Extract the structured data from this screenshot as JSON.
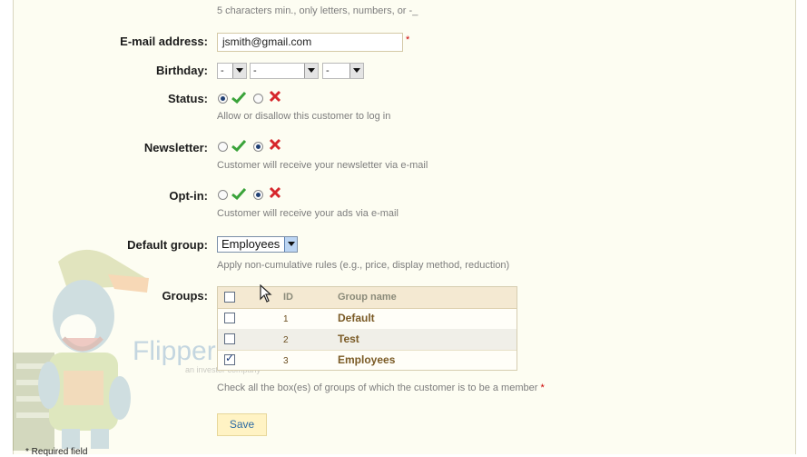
{
  "username_hint": "5 characters min., only letters, numbers, or -_",
  "email": {
    "label": "E-mail address:",
    "value": "jsmith@gmail.com",
    "required_mark": "*"
  },
  "birthday": {
    "label": "Birthday:",
    "day": "-",
    "month": "-",
    "year": "-"
  },
  "status": {
    "label": "Status:",
    "hint": "Allow or disallow this customer to log in",
    "selected": "enabled"
  },
  "newsletter": {
    "label": "Newsletter:",
    "hint": "Customer will receive your newsletter via e-mail",
    "selected": "disabled"
  },
  "optin": {
    "label": "Opt-in:",
    "hint": "Customer will receive your ads via e-mail",
    "selected": "disabled"
  },
  "default_group": {
    "label": "Default group:",
    "value": "Employees",
    "hint": "Apply non-cumulative rules (e.g., price, display method, reduction)"
  },
  "groups": {
    "label": "Groups:",
    "columns": {
      "id": "ID",
      "name": "Group name"
    },
    "rows": [
      {
        "id": "1",
        "name": "Default",
        "checked": false
      },
      {
        "id": "2",
        "name": "Test",
        "checked": false
      },
      {
        "id": "3",
        "name": "Employees",
        "checked": true
      }
    ],
    "hint": "Check all the box(es) of groups of which the customer is to be a member",
    "required_mark": "*"
  },
  "save_label": "Save",
  "footnote": "* Required field",
  "watermark": {
    "brand": "FlipperHost",
    "tagline": "an investor company"
  },
  "colors": {
    "panel_bg": "#fdfdf2",
    "check_green": "#3aa33a",
    "cross_red": "#d6262b",
    "link_brown": "#7a5a25"
  }
}
